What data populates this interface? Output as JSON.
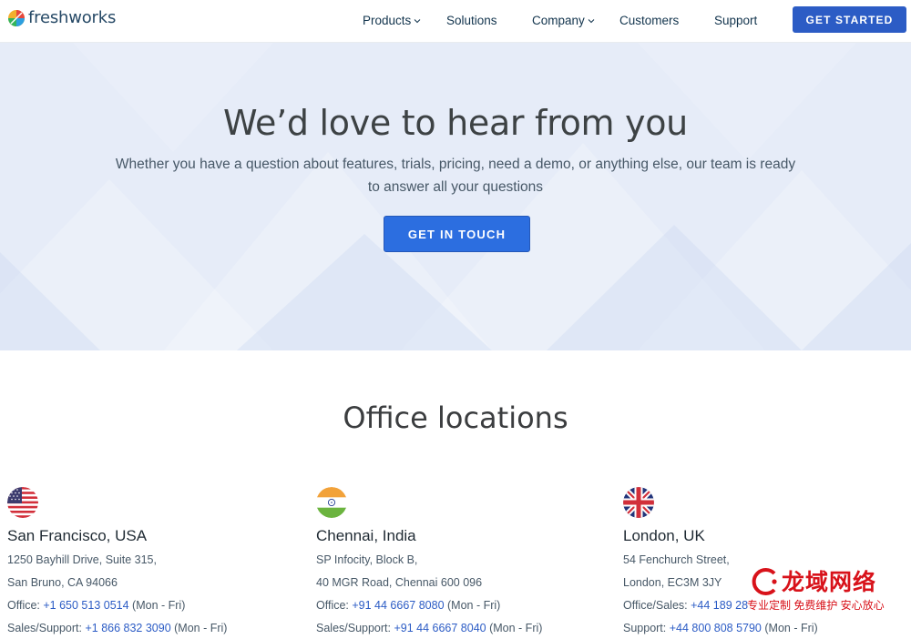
{
  "nav": {
    "logo_text": "freshworks",
    "items": [
      {
        "label": "Products",
        "has_dropdown": true
      },
      {
        "label": "Solutions",
        "has_dropdown": false
      },
      {
        "label": "Company",
        "has_dropdown": true
      },
      {
        "label": "Customers",
        "has_dropdown": false
      },
      {
        "label": "Support",
        "has_dropdown": false
      }
    ],
    "cta_label": "GET STARTED"
  },
  "hero": {
    "title": "We’d love to hear from you",
    "subtitle": "Whether you have a question about features, trials, pricing, need a demo, or anything else, our team is ready to answer all your questions",
    "button_label": "GET IN TOUCH"
  },
  "offices": {
    "title": "Office locations",
    "list": [
      {
        "flag": "usa-flag-icon",
        "city": "San Francisco, USA",
        "address1": "1250 Bayhill Drive, Suite 315,",
        "address2": "San Bruno, CA 94066",
        "phone1_label": "Office: ",
        "phone1": "+1 650 513 0514",
        "phone1_hours": " (Mon - Fri)",
        "phone2_label": "Sales/Support: ",
        "phone2": "+1 866 832 3090",
        "phone2_hours": " (Mon - Fri)"
      },
      {
        "flag": "india-flag-icon",
        "city": "Chennai, India",
        "address1": "SP Infocity, Block B,",
        "address2": "40 MGR Road, Chennai 600 096",
        "phone1_label": "Office: ",
        "phone1": "+91 44 6667 8080",
        "phone1_hours": " (Mon - Fri)",
        "phone2_label": "Sales/Support: ",
        "phone2": "+91 44 6667 8040",
        "phone2_hours": " (Mon - Fri)"
      },
      {
        "flag": "uk-flag-icon",
        "city": "London, UK",
        "address1": "54 Fenchurch Street,",
        "address2": "London, EC3M 3JY",
        "phone1_label": "Office/Sales: ",
        "phone1": "+44 189 28",
        "phone1_hours": "",
        "phone2_label": "Support: ",
        "phone2": "+44 800 808 5790",
        "phone2_hours": " (Mon - Fri)"
      }
    ]
  },
  "watermark": {
    "brand": "龙域网络",
    "tagline": "专业定制 免费维护 安心放心"
  },
  "colors": {
    "primary": "#2c5cc5",
    "hero_bg": "#e6ecf8",
    "watermark": "#d8121a"
  }
}
